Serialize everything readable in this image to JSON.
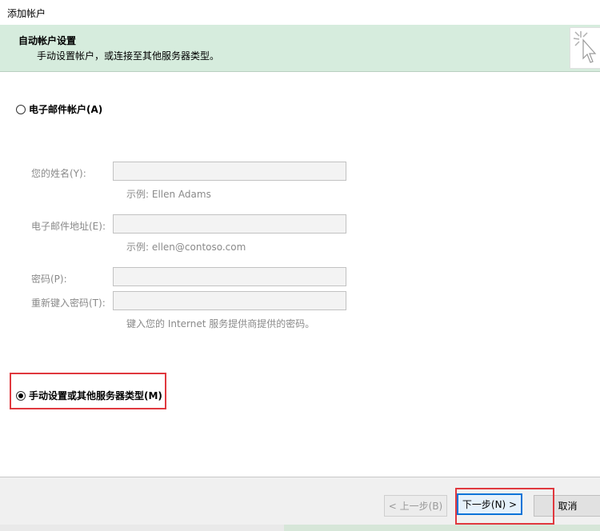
{
  "window": {
    "title": "添加帐户"
  },
  "header": {
    "title": "自动帐户设置",
    "subtitle": "手动设置帐户，或连接至其他服务器类型。",
    "icon": "cursor-sparkle-icon"
  },
  "email_option": {
    "label": "电子邮件帐户(A)",
    "selected": false
  },
  "fields": {
    "name_label": "您的姓名(Y):",
    "name_value": "",
    "name_hint": "示例: Ellen Adams",
    "email_label": "电子邮件地址(E):",
    "email_value": "",
    "email_hint": "示例: ellen@contoso.com",
    "password_label": "密码(P):",
    "password_value": "",
    "retype_label": "重新键入密码(T):",
    "retype_value": "",
    "password_hint": "键入您的 Internet 服务提供商提供的密码。"
  },
  "manual_option": {
    "label": "手动设置或其他服务器类型(M)",
    "selected": true
  },
  "buttons": {
    "prev": "< 上一步(B)",
    "next": "下一步(N) >",
    "cancel": "取消"
  },
  "colors": {
    "header_bg": "#d6ecdd",
    "highlight": "#e0383e",
    "focus": "#0a74d8"
  }
}
